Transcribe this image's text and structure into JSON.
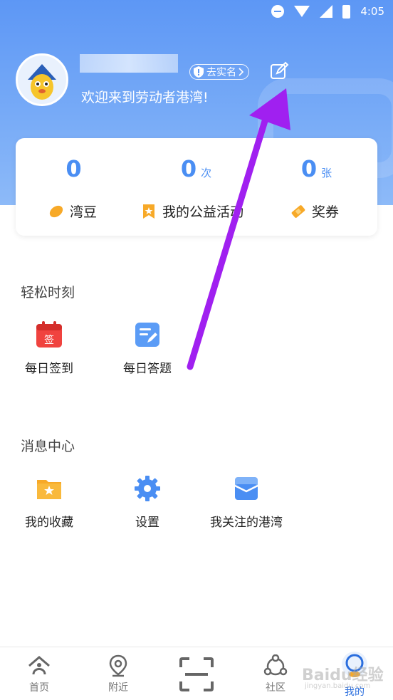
{
  "status_bar": {
    "time": "4:05"
  },
  "profile": {
    "verify_label": "去实名",
    "welcome": "欢迎来到劳动者港湾!"
  },
  "stats": [
    {
      "value": "0",
      "unit": "",
      "label": "湾豆",
      "icon": "bean-icon"
    },
    {
      "value": "0",
      "unit": "次",
      "label": "我的公益活动",
      "icon": "bookmark-star-icon"
    },
    {
      "value": "0",
      "unit": "张",
      "label": "奖券",
      "icon": "ticket-icon"
    }
  ],
  "sections": {
    "relax": {
      "title": "轻松时刻",
      "items": [
        {
          "label": "每日签到",
          "icon": "calendar-sign-icon",
          "icon_text": "签"
        },
        {
          "label": "每日答题",
          "icon": "quiz-edit-icon"
        }
      ]
    },
    "messages": {
      "title": "消息中心",
      "items": [
        {
          "label": "我的收藏",
          "icon": "folder-star-icon"
        },
        {
          "label": "设置",
          "icon": "gear-icon"
        },
        {
          "label": "我关注的港湾",
          "icon": "inbox-icon"
        }
      ]
    }
  },
  "nav": [
    {
      "label": "首页",
      "icon": "home-icon"
    },
    {
      "label": "附近",
      "icon": "location-pin-icon"
    },
    {
      "label": "",
      "icon": "scan-icon"
    },
    {
      "label": "社区",
      "icon": "community-icon"
    },
    {
      "label": "我的",
      "icon": "mascot-icon",
      "active": true
    }
  ],
  "watermark": {
    "text": "Baidu经验",
    "sub": "jingyan.baidu.com"
  },
  "colors": {
    "accent": "#4a8ef3",
    "header_top": "#5d97f5",
    "arrow": "#a020f0",
    "calendar_red": "#f0433f",
    "folder_orange": "#f7a928"
  }
}
